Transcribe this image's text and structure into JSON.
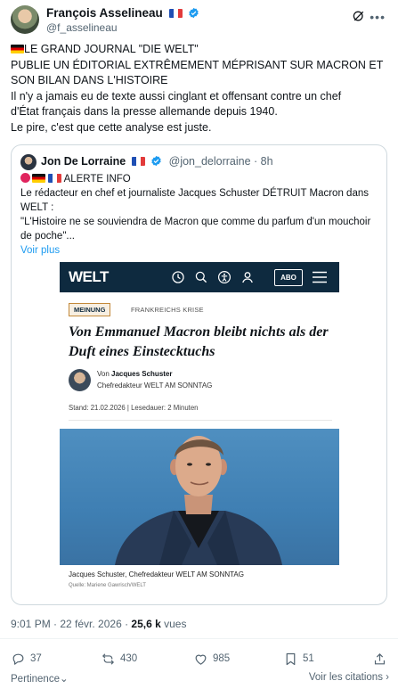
{
  "post": {
    "author_name": "François Asselineau",
    "author_handle": "@f_asselineau",
    "text_lines": [
      "LE GRAND JOURNAL \"DIE WELT\"",
      "PUBLIE UN ÉDITORIAL EXTRÊMEMENT MÉPRISANT SUR MACRON ET",
      "SON BILAN DANS L'HISTOIRE",
      "Il n'y a jamais eu de texte aussi cinglant et offensant contre un chef",
      "d'État français dans la presse allemande depuis 1940.",
      "Le pire, c'est que cette analyse est juste."
    ],
    "timestamp": "9:01 PM · 22 févr. 2026 · ",
    "views_count": "25,6 k",
    "views_label": " vues"
  },
  "quote": {
    "author_name": "Jon De Lorraine",
    "author_handle": "@jon_delorraine · 8h",
    "alert": "ALERTE INFO",
    "body_lines": [
      "Le rédacteur en chef et journaliste Jacques Schuster DÉTRUIT Macron dans",
      "WELT :",
      "\"L'Histoire ne se souviendra de Macron que comme du parfum d'un mouchoir",
      "de poche\"..."
    ],
    "voir_plus": "Voir plus"
  },
  "article": {
    "logo": "WELT",
    "abo": "ABO",
    "kicker": "MEINUNG",
    "rubrik": "FRANKREICHS KRISE",
    "headline": "Von Emmanuel Macron bleibt nichts als der Duft eines Einstecktuchs",
    "by_prefix": "Von ",
    "author": "Jacques Schuster",
    "author_role": "Chefredakteur WELT AM SONNTAG",
    "stand": "Stand: 21.02.2026  |  Lesedauer: 2 Minuten",
    "caption": "Jacques Schuster, Chefredakteur WELT AM SONNTAG",
    "credit": "Quelle: Mariene Gawrisch/WELT"
  },
  "actions": {
    "replies": "37",
    "reposts": "430",
    "likes": "985",
    "bookmarks": "51"
  },
  "footer": {
    "pertinence": "Pertinence",
    "voir_citations": "Voir les citations"
  },
  "colors": {
    "accent": "#1d9bf0",
    "welt_navy": "#0e2a3f",
    "secondary_text": "#536471"
  },
  "icons": [
    "verified-badge-icon",
    "grok-icon",
    "more-icon",
    "reply-icon",
    "repost-icon",
    "like-icon",
    "bookmark-icon",
    "clock-icon",
    "search-icon",
    "accessibility-icon",
    "account-icon",
    "menu-icon"
  ]
}
